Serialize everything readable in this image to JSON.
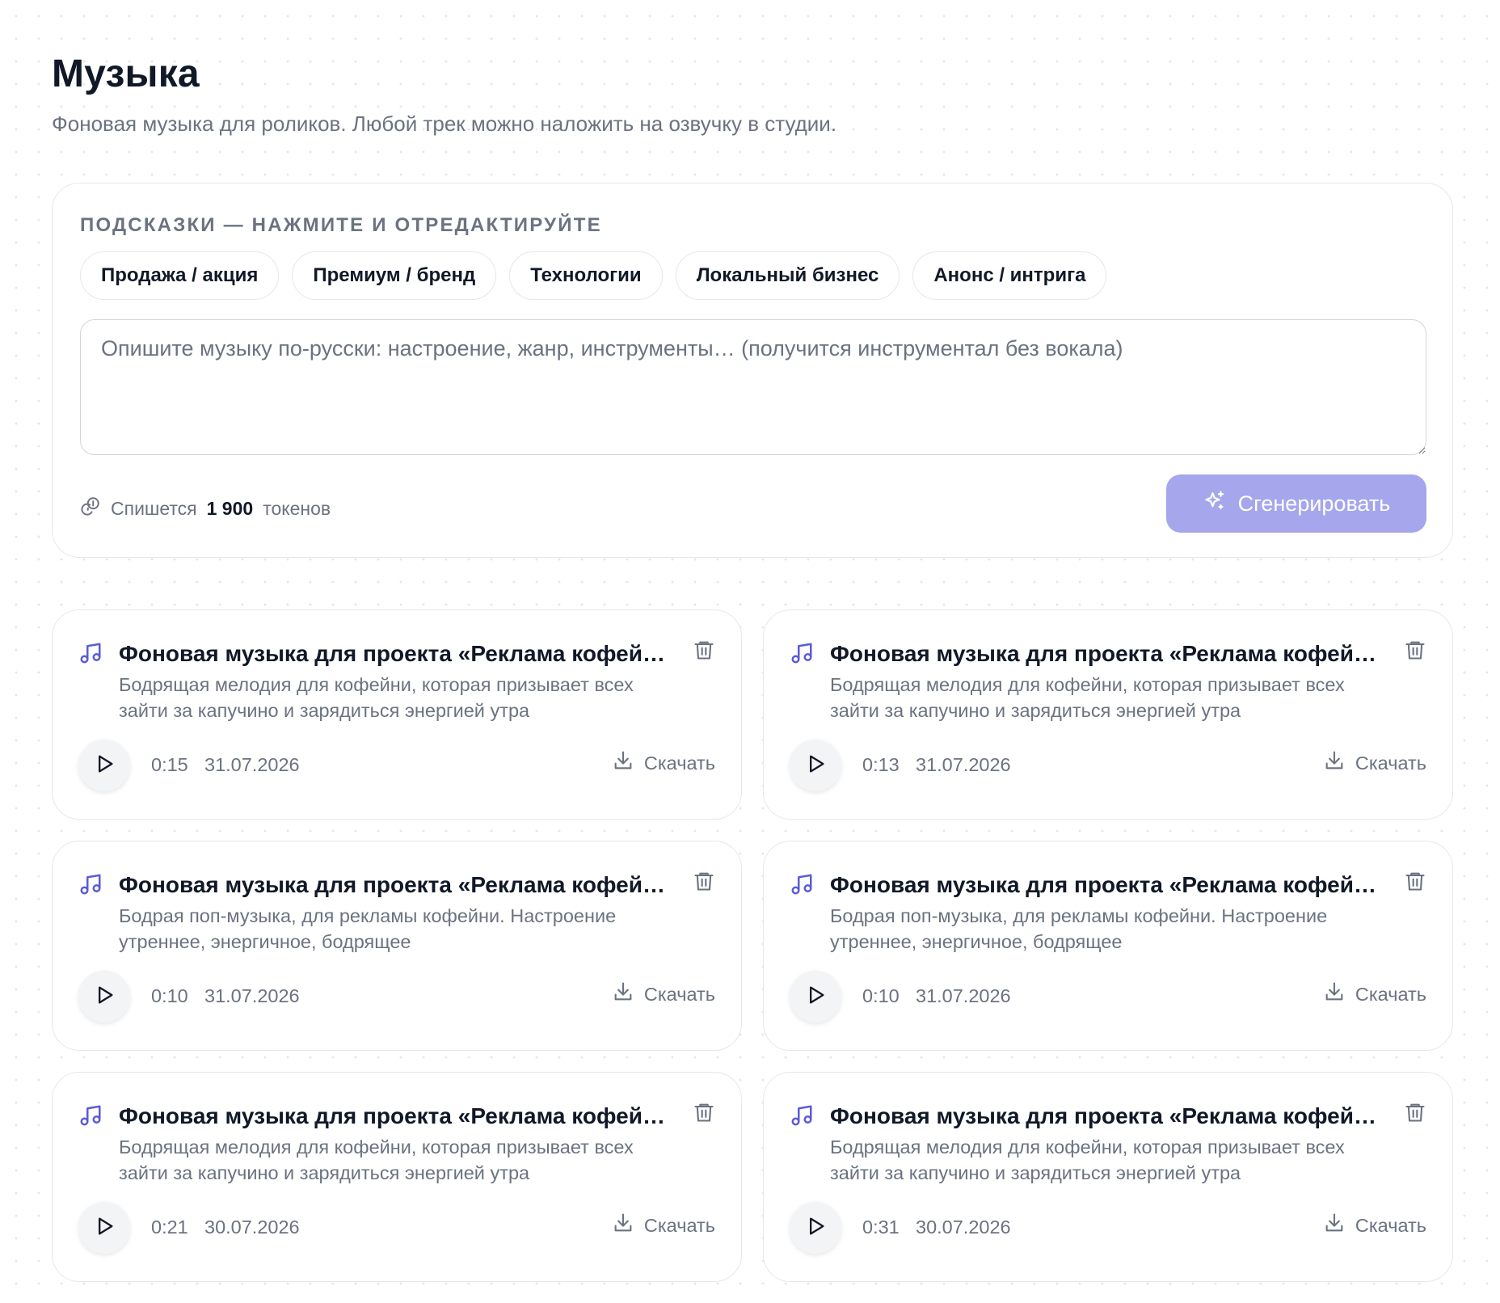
{
  "header": {
    "title": "Музыка",
    "subtitle": "Фоновая музыка для роликов. Любой трек можно наложить на озвучку в студии."
  },
  "generator": {
    "hints_label": "ПОДСКАЗКИ — НАЖМИТЕ И ОТРЕДАКТИРУЙТЕ",
    "hints": [
      {
        "label": "Продажа / акция"
      },
      {
        "label": "Премиум / бренд"
      },
      {
        "label": "Технологии"
      },
      {
        "label": "Локальный бизнес"
      },
      {
        "label": "Анонс / интрига"
      }
    ],
    "prompt_placeholder": "Опишите музыку по-русски: настроение, жанр, инструменты… (получится инструментал без вокала)",
    "prompt_value": "",
    "cost_prefix": "Спишется",
    "cost_amount": "1 900",
    "cost_suffix": "токенов",
    "generate_label": "Сгенерировать",
    "generate_color": "#a5a6ec"
  },
  "tracks": [
    {
      "title": "Фоновая музыка для проекта «Реклама кофейни»",
      "description": "Бодрящая мелодия для кофейни, которая призывает всех зайти за капучино и зарядиться энергией утра",
      "duration": "0:15",
      "date": "31.07.2026",
      "download_label": "Скачать"
    },
    {
      "title": "Фоновая музыка для проекта «Реклама кофейни»",
      "description": "Бодрящая мелодия для кофейни, которая призывает всех зайти за капучино и зарядиться энергией утра",
      "duration": "0:13",
      "date": "31.07.2026",
      "download_label": "Скачать"
    },
    {
      "title": "Фоновая музыка для проекта «Реклама кофейни»",
      "description": "Бодрая поп-музыка, для рекламы кофейни. Настроение утреннее, энергичное, бодрящее",
      "duration": "0:10",
      "date": "31.07.2026",
      "download_label": "Скачать"
    },
    {
      "title": "Фоновая музыка для проекта «Реклама кофейни»",
      "description": "Бодрая поп-музыка, для рекламы кофейни. Настроение утреннее, энергичное, бодрящее",
      "duration": "0:10",
      "date": "31.07.2026",
      "download_label": "Скачать"
    },
    {
      "title": "Фоновая музыка для проекта «Реклама кофейни»",
      "description": "Бодрящая мелодия для кофейни, которая призывает всех зайти за капучино и зарядиться энергией утра",
      "duration": "0:21",
      "date": "30.07.2026",
      "download_label": "Скачать"
    },
    {
      "title": "Фоновая музыка для проекта «Реклама кофейни»",
      "description": "Бодрящая мелодия для кофейни, которая призывает всех зайти за капучино и зарядиться энергией утра",
      "duration": "0:31",
      "date": "30.07.2026",
      "download_label": "Скачать"
    }
  ],
  "icons": {
    "note": "music-note-icon",
    "delete": "trash-icon",
    "play": "play-icon",
    "download": "download-icon",
    "cost": "coins-icon",
    "generate": "sparkles-icon"
  },
  "colors": {
    "accent": "#5b5bd6",
    "text": "#111827",
    "muted": "#6b7280",
    "border": "#e5e7eb"
  }
}
